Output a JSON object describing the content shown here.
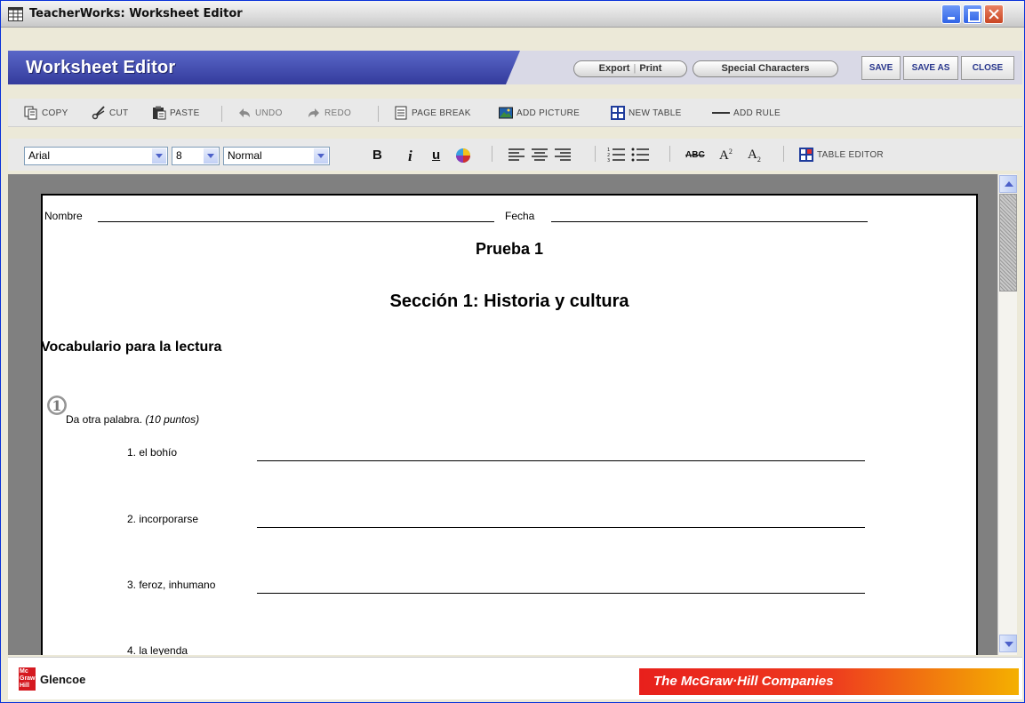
{
  "window": {
    "title": "TeacherWorks: Worksheet Editor"
  },
  "header": {
    "app_title": "Worksheet Editor",
    "export_label": "Export",
    "print_label": "Print",
    "special_chars_label": "Special Characters",
    "save_label": "SAVE",
    "save_as_label": "SAVE AS",
    "close_label": "CLOSE"
  },
  "toolbar1": {
    "copy": "COPY",
    "cut": "CUT",
    "paste": "PASTE",
    "undo": "UNDO",
    "redo": "REDO",
    "page_break": "PAGE BREAK",
    "add_picture": "ADD PICTURE",
    "new_table": "NEW TABLE",
    "add_rule": "ADD RULE"
  },
  "toolbar2": {
    "font": "Arial",
    "size": "8",
    "style": "Normal",
    "bold": "B",
    "italic": "i",
    "underline": "u",
    "strike": "ABC",
    "superscript": "A",
    "subscript": "A",
    "table_editor": "TABLE EDITOR"
  },
  "document": {
    "name_label": "Nombre",
    "date_label": "Fecha",
    "title": "Prueba 1",
    "section": "Sección 1: Historia y cultura",
    "subheading": "Vocabulario para la lectura",
    "exercise_number": "1",
    "instruction": "Da otra palabra.",
    "points": "(10 puntos)",
    "items": [
      "1. el bohío",
      "2. incorporarse",
      "3. feroz, inhumano",
      "4. la leyenda"
    ]
  },
  "footer": {
    "logo_text": "Mc Graw Hill",
    "brand": "Glencoe",
    "banner": "The McGraw·Hill Companies"
  }
}
